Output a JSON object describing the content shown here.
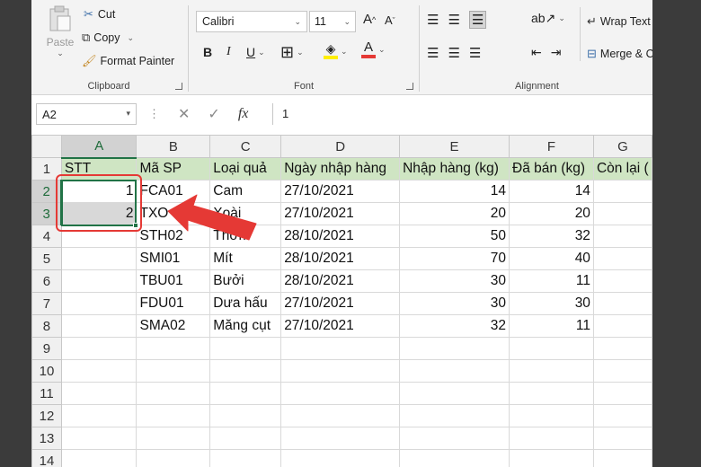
{
  "clipboard": {
    "paste": "Paste",
    "cut": "Cut",
    "copy": "Copy",
    "format_painter": "Format Painter",
    "label": "Clipboard"
  },
  "font": {
    "name": "Calibri",
    "size": "11",
    "grow": "A",
    "shrink": "A",
    "bold": "B",
    "italic": "I",
    "underline": "U",
    "font_color": "A",
    "label": "Font"
  },
  "alignment": {
    "wrap_text": "Wrap Text",
    "merge_center": "Merge & Center",
    "label": "Alignment"
  },
  "formula_bar": {
    "name_box": "A2",
    "fx": "fx",
    "value": "1"
  },
  "sheet": {
    "columns": [
      "A",
      "B",
      "C",
      "D",
      "E",
      "F",
      "G"
    ],
    "rows": [
      [
        "STT",
        "Mã SP",
        "Loại quả",
        "Ngày nhập hàng",
        "Nhập hàng (kg)",
        "Đã bán (kg)",
        "Còn lại ("
      ],
      [
        "1",
        "FCA01",
        "Cam",
        "27/10/2021",
        "14",
        "14",
        ""
      ],
      [
        "2",
        "TXO",
        "Xoài",
        "27/10/2021",
        "20",
        "20",
        ""
      ],
      [
        "",
        "STH02",
        "Thơm",
        "28/10/2021",
        "50",
        "32",
        ""
      ],
      [
        "",
        "SMI01",
        "Mít",
        "28/10/2021",
        "70",
        "40",
        ""
      ],
      [
        "",
        "TBU01",
        "Bưởi",
        "28/10/2021",
        "30",
        "11",
        ""
      ],
      [
        "",
        "FDU01",
        "Dưa hấu",
        "27/10/2021",
        "30",
        "30",
        ""
      ],
      [
        "",
        "SMA02",
        "Măng cụt",
        "27/10/2021",
        "32",
        "11",
        ""
      ],
      [
        "",
        "",
        "",
        "",
        "",
        "",
        ""
      ],
      [
        "",
        "",
        "",
        "",
        "",
        "",
        ""
      ],
      [
        "",
        "",
        "",
        "",
        "",
        "",
        ""
      ],
      [
        "",
        "",
        "",
        "",
        "",
        "",
        ""
      ],
      [
        "",
        "",
        "",
        "",
        "",
        "",
        ""
      ],
      [
        "",
        "",
        "",
        "",
        "",
        "",
        ""
      ]
    ],
    "row_numbers": [
      "1",
      "2",
      "3",
      "4",
      "5",
      "6",
      "7",
      "8",
      "9",
      "10",
      "11",
      "12",
      "13",
      "14"
    ]
  },
  "colors": {
    "header_fill": "#cfe5c3",
    "selection": "#217346",
    "annotation": "#e53935"
  }
}
